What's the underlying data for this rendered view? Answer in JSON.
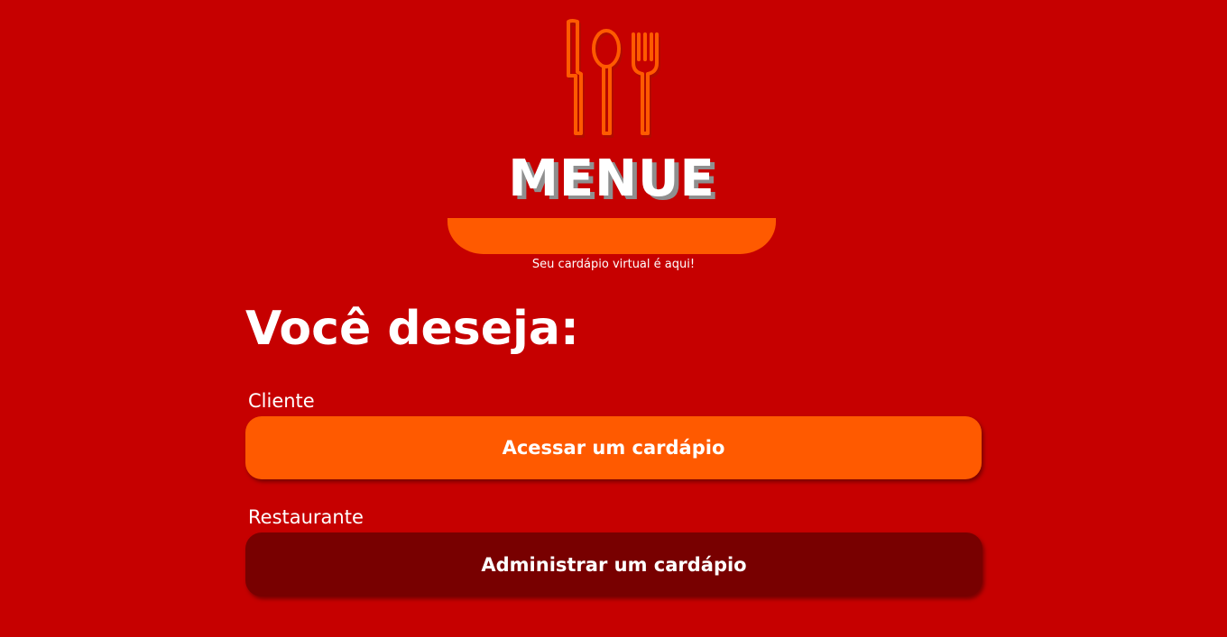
{
  "brand": {
    "name": "MENUE",
    "tagline": "Seu cardápio virtual é aqui!",
    "accent_color": "#ff5a00",
    "background_color": "#c60000",
    "icon": "cutlery-icon"
  },
  "main": {
    "question": "Você deseja:",
    "options": [
      {
        "label": "Cliente",
        "button_label": "Acessar um cardápio",
        "button_color": "#ff5a00"
      },
      {
        "label": "Restaurante",
        "button_label": "Administrar um cardápio",
        "button_color": "#780000"
      }
    ]
  }
}
